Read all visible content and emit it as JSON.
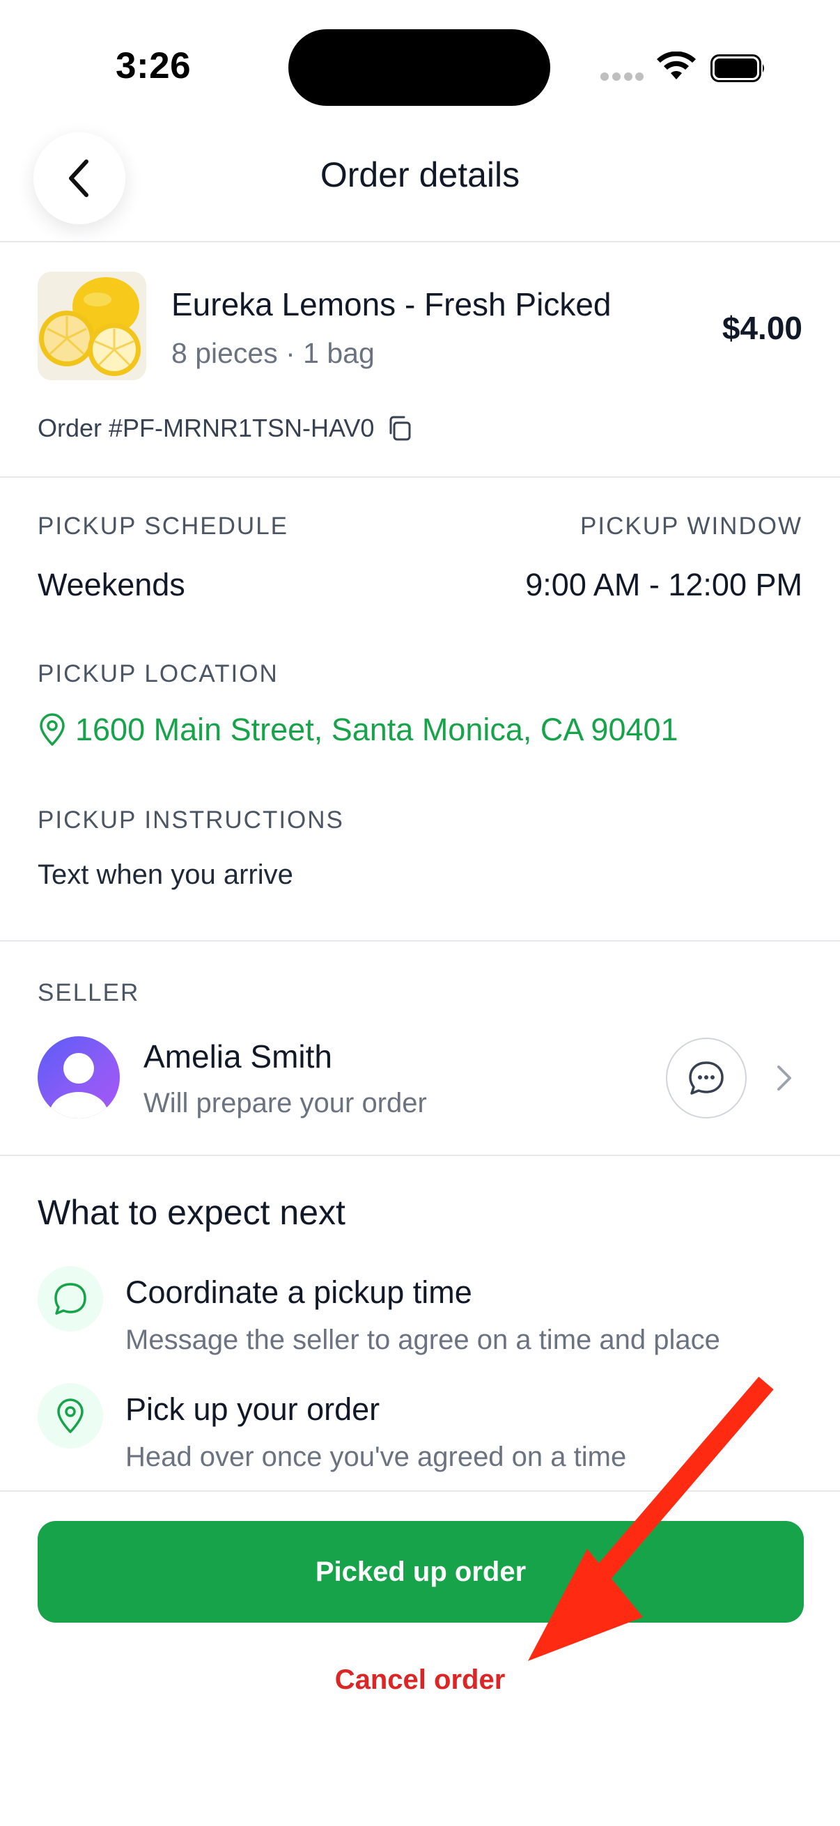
{
  "status_bar": {
    "time": "3:26"
  },
  "header": {
    "title": "Order details",
    "back_icon": "chevron-left-icon"
  },
  "product": {
    "name": "Eureka Lemons - Fresh Picked",
    "meta": "8 pieces · 1 bag",
    "price": "$4.00",
    "order_number": "Order #PF-MRNR1TSN-HAV0",
    "copy_icon": "copy-icon"
  },
  "pickup": {
    "schedule_label": "PICKUP SCHEDULE",
    "schedule_value": "Weekends",
    "window_label": "PICKUP WINDOW",
    "window_value": "9:00 AM - 12:00 PM",
    "location_label": "PICKUP LOCATION",
    "location_value": "1600 Main Street, Santa Monica, CA 90401",
    "instructions_label": "PICKUP INSTRUCTIONS",
    "instructions_value": "Text when you arrive"
  },
  "seller": {
    "label": "SELLER",
    "name": "Amelia Smith",
    "subtitle": "Will prepare your order"
  },
  "expect": {
    "title": "What to expect next",
    "steps": [
      {
        "title": "Coordinate a pickup time",
        "desc": "Message the seller to agree on a time and place",
        "icon": "chat-bubble-icon"
      },
      {
        "title": "Pick up your order",
        "desc": "Head over once you've agreed on a time",
        "icon": "map-pin-icon"
      }
    ]
  },
  "actions": {
    "primary_label": "Picked up order",
    "cancel_label": "Cancel order"
  },
  "colors": {
    "accent_green": "#16a34a",
    "danger_red": "#dc2626",
    "annotation_arrow": "#ff2a12"
  }
}
